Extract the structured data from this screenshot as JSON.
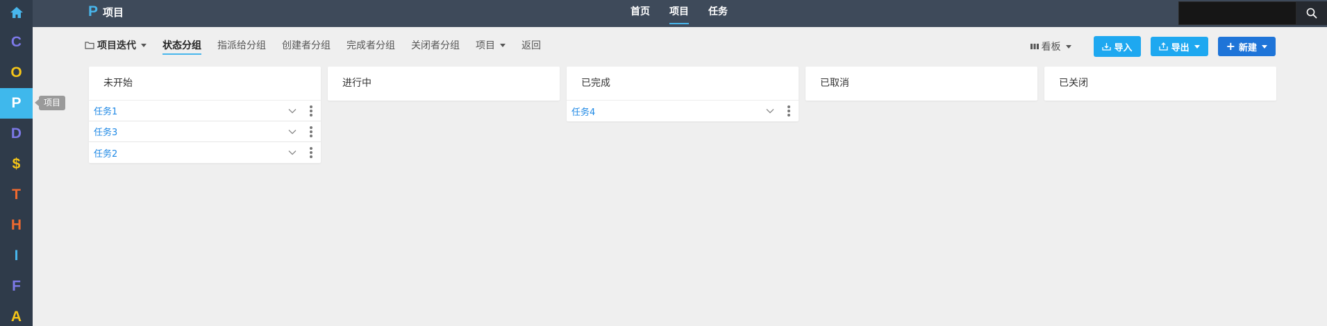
{
  "rail": {
    "items": [
      {
        "letter": "",
        "icon": "home-icon",
        "color": "#48b6ec"
      },
      {
        "letter": "C",
        "color": "#7d79e8"
      },
      {
        "letter": "O",
        "color": "#f5c518"
      },
      {
        "letter": "P",
        "color": "#ffffff"
      },
      {
        "letter": "D",
        "color": "#7d79e8"
      },
      {
        "letter": "$",
        "color": "#f5c518"
      },
      {
        "letter": "T",
        "color": "#f06a2f"
      },
      {
        "letter": "H",
        "color": "#f06a2f"
      },
      {
        "letter": "I",
        "color": "#48b6ec"
      },
      {
        "letter": "F",
        "color": "#7d79e8"
      },
      {
        "letter": "A",
        "color": "#f5c518"
      }
    ],
    "active_index": 3,
    "tooltip": "项目"
  },
  "header": {
    "brand_letter": "P",
    "brand_title": "项目",
    "nav": [
      "首页",
      "项目",
      "任务"
    ],
    "nav_active": 1,
    "search_placeholder": ""
  },
  "toolbar": {
    "iteration_label": "项目迭代",
    "groups": [
      "状态分组",
      "指派给分组",
      "创建者分组",
      "完成者分组",
      "关闭者分组"
    ],
    "active_group": 0,
    "project_label": "项目",
    "back_label": "返回",
    "view_label": "看板",
    "import_label": "导入",
    "export_label": "导出",
    "new_label": "新建"
  },
  "board": {
    "columns": [
      {
        "title": "未开始",
        "cards": [
          "任务1",
          "任务3",
          "任务2"
        ]
      },
      {
        "title": "进行中",
        "cards": []
      },
      {
        "title": "已完成",
        "cards": [
          "任务4"
        ]
      },
      {
        "title": "已取消",
        "cards": []
      },
      {
        "title": "已关闭",
        "cards": []
      }
    ]
  },
  "colors": {
    "accent": "#48b6ec",
    "link": "#1e88e5",
    "rail_bg": "#2f3b4a",
    "topbar_bg": "#3e4a5a"
  }
}
